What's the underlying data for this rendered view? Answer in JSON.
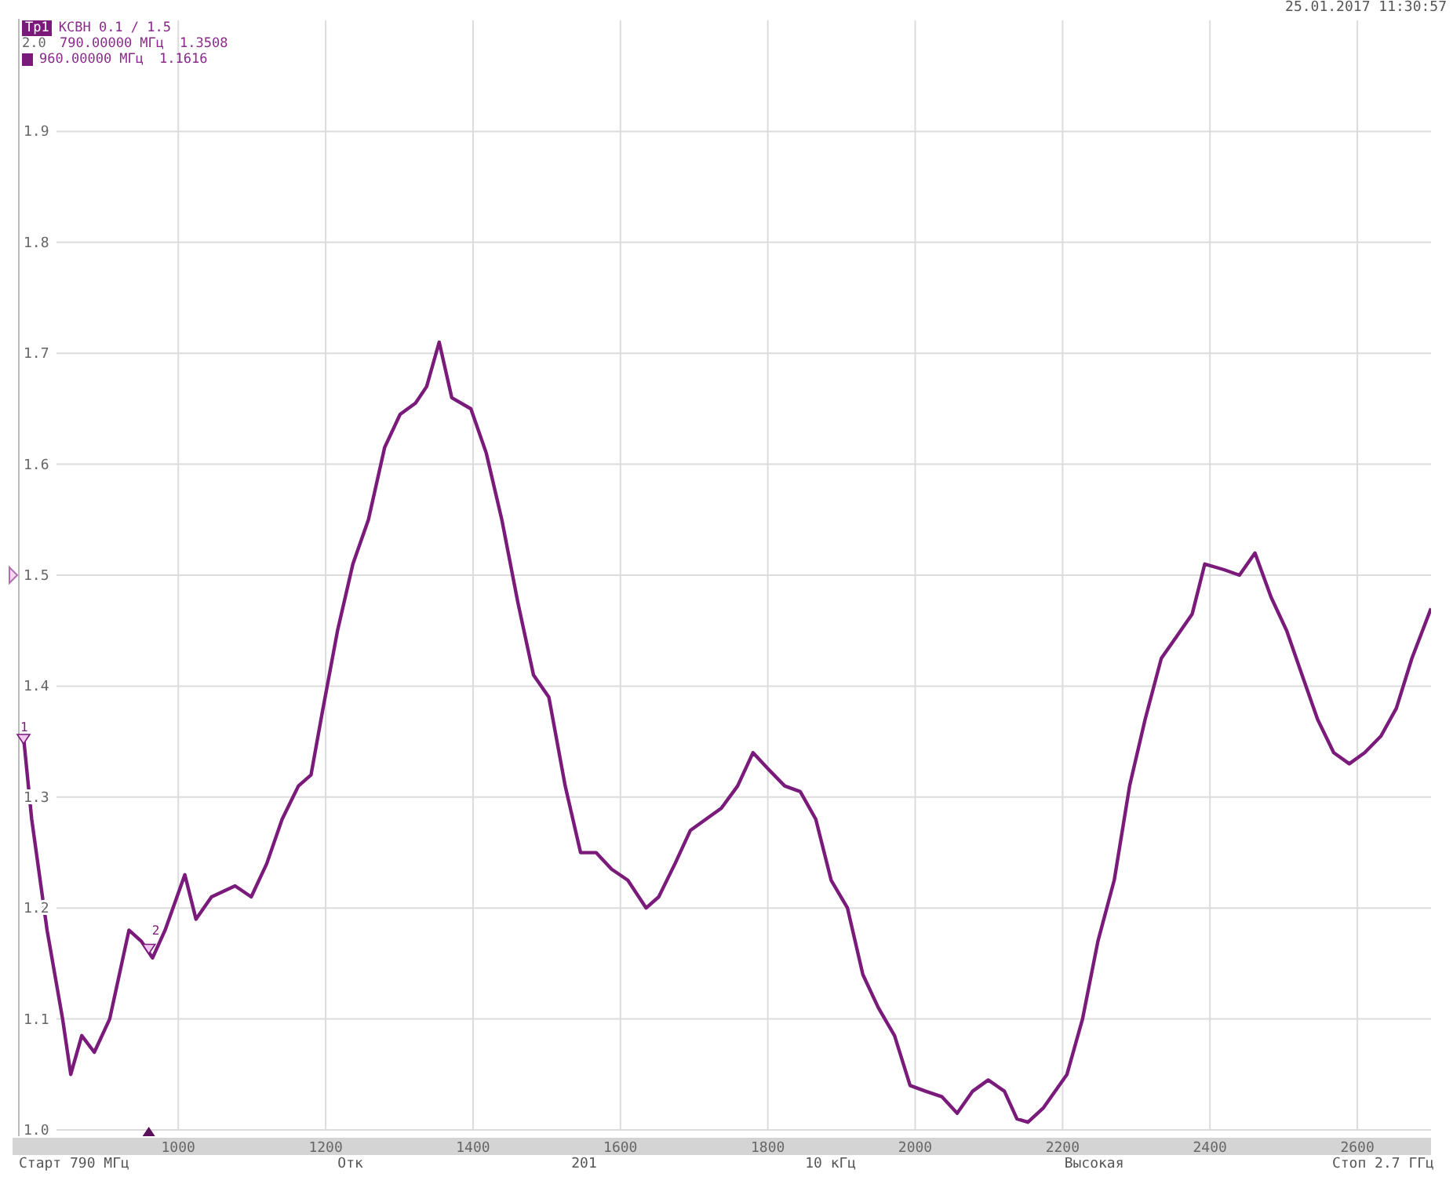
{
  "header": {
    "timestamp": "25.01.2017 11:30:57"
  },
  "trace": {
    "format": "КСВН 0.1 / 1.5",
    "scale_label": "2.0",
    "markers": [
      {
        "badge": false,
        "readout": "790.00000 МГц",
        "value": "1.3508"
      },
      {
        "badge": true,
        "readout": "960.00000 МГц",
        "value": "1.1616"
      }
    ]
  },
  "chart_data": {
    "type": "line",
    "grid": true,
    "xlim": [
      790,
      2700
    ],
    "ylim": [
      1,
      2
    ],
    "xticks": [
      1000,
      1200,
      1400,
      1600,
      1800,
      2000,
      2200,
      2400,
      2600
    ],
    "yticks": [
      {
        "value": 1,
        "label": "1.0"
      },
      {
        "value": 1.1,
        "label": "1.1"
      },
      {
        "value": 1.2,
        "label": "1.2"
      },
      {
        "value": 1.3,
        "label": "1.3"
      },
      {
        "value": 1.4,
        "label": "1.4"
      },
      {
        "value": 1.5,
        "label": "1.5"
      },
      {
        "value": 1.6,
        "label": "1.6"
      },
      {
        "value": 1.7,
        "label": "1.7"
      },
      {
        "value": 1.8,
        "label": "1.8"
      },
      {
        "value": 1.9,
        "label": "1.9"
      }
    ],
    "x": [
      790,
      801,
      822,
      843,
      854,
      869,
      886,
      907,
      933,
      950,
      965,
      982,
      1009,
      1024,
      1045,
      1077,
      1099,
      1120,
      1141,
      1163,
      1180,
      1195,
      1216,
      1237,
      1258,
      1280,
      1301,
      1322,
      1337,
      1354,
      1371,
      1397,
      1418,
      1439,
      1461,
      1482,
      1503,
      1525,
      1546,
      1567,
      1588,
      1610,
      1635,
      1652,
      1674,
      1695,
      1716,
      1737,
      1759,
      1780,
      1801,
      1823,
      1844,
      1865,
      1886,
      1908,
      1929,
      1950,
      1972,
      1993,
      2014,
      2036,
      2057,
      2078,
      2099,
      2121,
      2138,
      2153,
      2174,
      2206,
      2227,
      2248,
      2270,
      2291,
      2312,
      2334,
      2355,
      2376,
      2393,
      2419,
      2440,
      2461,
      2483,
      2504,
      2525,
      2546,
      2568,
      2589,
      2610,
      2632,
      2653,
      2674,
      2700
    ],
    "series": [
      {
        "name": "Тр1",
        "color": "#7a1a7a",
        "values": [
          1.354,
          1.28,
          1.18,
          1.1,
          1.05,
          1.085,
          1.07,
          1.1,
          1.18,
          1.17,
          1.155,
          1.18,
          1.23,
          1.19,
          1.21,
          1.22,
          1.21,
          1.24,
          1.28,
          1.31,
          1.32,
          1.375,
          1.45,
          1.51,
          1.55,
          1.615,
          1.645,
          1.655,
          1.67,
          1.71,
          1.66,
          1.65,
          1.61,
          1.55,
          1.475,
          1.41,
          1.39,
          1.31,
          1.25,
          1.25,
          1.235,
          1.225,
          1.2,
          1.21,
          1.24,
          1.27,
          1.28,
          1.29,
          1.31,
          1.34,
          1.325,
          1.31,
          1.305,
          1.28,
          1.225,
          1.2,
          1.14,
          1.11,
          1.085,
          1.04,
          1.035,
          1.03,
          1.015,
          1.035,
          1.045,
          1.035,
          1.01,
          1.007,
          1.02,
          1.05,
          1.1,
          1.17,
          1.225,
          1.31,
          1.37,
          1.425,
          1.445,
          1.465,
          1.51,
          1.505,
          1.5,
          1.52,
          1.48,
          1.45,
          1.41,
          1.37,
          1.34,
          1.33,
          1.34,
          1.355,
          1.38,
          1.425,
          1.47
        ]
      }
    ],
    "annotations": [
      {
        "x": 790,
        "y": 1.3508,
        "text": "1"
      },
      {
        "x": 960,
        "y": 1.1616,
        "text": "2"
      }
    ]
  },
  "status_bar": [
    "Старт 790 МГц",
    "Отк",
    "201",
    "10 кГц",
    "Высокая",
    "Стоп 2.7 ГГц"
  ]
}
